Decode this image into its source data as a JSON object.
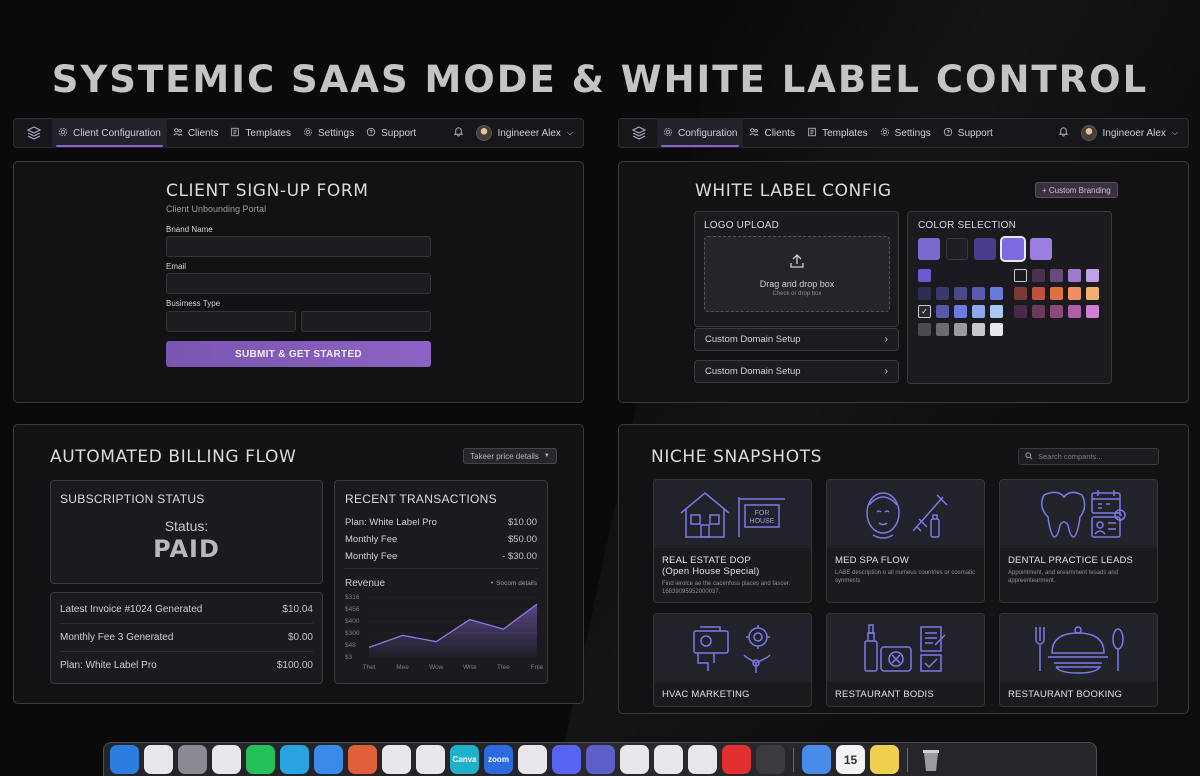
{
  "headline": "SYSTEMIC SAAS MODE & WHITE LABEL CONTROL",
  "nav_left": {
    "items": [
      {
        "label": "Client Configuration",
        "icon": "gear-icon",
        "active": true
      },
      {
        "label": "Clients",
        "icon": "users-icon"
      },
      {
        "label": "Templates",
        "icon": "template-icon"
      },
      {
        "label": "Settings",
        "icon": "gear-icon"
      },
      {
        "label": "Support",
        "icon": "help-icon"
      }
    ],
    "user": "Ingineeer Alex"
  },
  "nav_right": {
    "items": [
      {
        "label": "Configuration",
        "icon": "gear-icon",
        "active": true
      },
      {
        "label": "Clients",
        "icon": "users-icon"
      },
      {
        "label": "Templates",
        "icon": "template-icon"
      },
      {
        "label": "Settings",
        "icon": "gear-icon"
      },
      {
        "label": "Support",
        "icon": "help-icon"
      }
    ],
    "user": "Ingineoer Alex"
  },
  "signup": {
    "title": "CLIENT SIGN-UP FORM",
    "subtitle": "Client Unbounding Portal",
    "brand_label": "Bnand Name",
    "email_label": "Email",
    "business_label": "Busimess Type",
    "submit": "SUBMIT & GET STARTED"
  },
  "whitelabel": {
    "title": "WHITE LABEL CONFIG",
    "custom_branding": "+ Custom Branding",
    "logo_upload": "LOGO UPLOAD",
    "drop_title": "Drag and drop box",
    "drop_sub": "Check or drop box",
    "domain_1": "Custom Domain Setup",
    "domain_2": "Custom Domain Setup",
    "color_selection": "COLOR SELECTION",
    "top_swatches": [
      "#7a6ad0",
      "#1e1e24",
      "#4a3c8a",
      "#7e6ae0",
      "#9a80e0"
    ],
    "grid_left": [
      [
        "#6a5ad0",
        null,
        null,
        null,
        null
      ],
      [
        "#2e2e52",
        "#3a3a6a",
        "#4a4a8a",
        "#5a5ab0",
        "#6a7ad8"
      ],
      [
        "check",
        "#5a5aa8",
        "#6a7ae0",
        "#8aaaf0",
        "#a8c8f0"
      ],
      [
        "#4a4a52",
        "#6a6a72",
        "#9a9aa2",
        "#c8c8cc",
        "#e8e8ec"
      ]
    ],
    "grid_right": [
      [
        "outline",
        "#4a3250",
        "#6a4a7a",
        "#a07ad0",
        "#c0a0e8"
      ],
      [
        "#7a3a3a",
        "#c05040",
        "#e07040",
        "#f09060",
        "#f0b070"
      ],
      [
        "#4a2a4a",
        "#6a3a5a",
        "#8a4a7a",
        "#b060a8",
        "#d080d0"
      ]
    ]
  },
  "billing": {
    "title": "AUTOMATED BILLING FLOW",
    "dropdown": "Takeer price details",
    "sub_status_title": "SUBSCRIPTION STATUS",
    "status_label": "Status:",
    "status_value": "PAID",
    "rows": [
      {
        "label": "Latest Invoice #1024 Generated",
        "value": "$10.04"
      },
      {
        "label": "Monthly Fee 3 Generated",
        "value": "$0.00"
      },
      {
        "label": "Plan: White Label Pro",
        "value": "$100.00"
      }
    ],
    "recent_title": "RECENT TRANSACTIONS",
    "transactions": [
      {
        "label": "Plan: White Label Pro",
        "value": "$10.00"
      },
      {
        "label": "Monthly Fee",
        "value": "$50.00"
      },
      {
        "label": "Monthly Fee",
        "value": "- $30.00"
      }
    ],
    "revenue_label": "Revenue",
    "revenue_link": "Socom details"
  },
  "chart_data": {
    "type": "area",
    "title": "Revenue",
    "categories": [
      "Thet",
      "Mee",
      "Wow",
      "Wrte",
      "Tfee",
      "Fnie"
    ],
    "y_ticks": [
      "$316",
      "$456",
      "$400",
      "$300",
      "$48",
      "$3"
    ],
    "values": [
      20,
      45,
      32,
      78,
      58,
      110
    ],
    "ylim": [
      0,
      125
    ]
  },
  "niche": {
    "title": "NICHE SNAPSHOTS",
    "search_placeholder": "Search compants...",
    "tiles": [
      {
        "title": "REAL ESTATE DOP\n(Open House Special)",
        "desc": "Find ierolce ae the cacenfoss places and fascer. 16839095952000037.",
        "icon": "house-icon",
        "sign": "FOR HOUSE"
      },
      {
        "title": "MED SPA FLOW",
        "desc": "LABE description o all numeus countries or cosmatic synmests",
        "icon": "face-syringe-icon"
      },
      {
        "title": "DENTAL PRACTICE LEADS",
        "desc": "Appointment, and ereamment tesads and appreentearment.",
        "icon": "tooth-calendar-icon"
      },
      {
        "title": "HVAC MARKETING",
        "desc": "",
        "icon": "hvac-icon"
      },
      {
        "title": "RESTAURANT BODIS",
        "desc": "",
        "icon": "restaurant-icon"
      },
      {
        "title": "RESTAURANT BOOKING",
        "desc": "",
        "icon": "cloche-icon"
      }
    ]
  },
  "dock": {
    "icons": [
      {
        "name": "finder-icon",
        "color": "#2b7de0",
        "label": ""
      },
      {
        "name": "launchpad-icon",
        "color": "#e8e8ec",
        "label": ""
      },
      {
        "name": "settings-icon",
        "color": "#8a8a92",
        "label": ""
      },
      {
        "name": "creative-cloud-icon",
        "color": "#e8e8ec",
        "label": ""
      },
      {
        "name": "whatsapp-icon",
        "color": "#25c05a",
        "label": ""
      },
      {
        "name": "telegram-icon",
        "color": "#2aa3e0",
        "label": ""
      },
      {
        "name": "mail-icon",
        "color": "#3a8ae8",
        "label": ""
      },
      {
        "name": "claude-icon",
        "color": "#e0603a",
        "label": ""
      },
      {
        "name": "gemini-icon",
        "color": "#e8e8ec",
        "label": ""
      },
      {
        "name": "chrome-icon",
        "color": "#e8e8ec",
        "label": ""
      },
      {
        "name": "canva-icon",
        "color": "#20b0c8",
        "label": "Canva"
      },
      {
        "name": "zoom-icon",
        "color": "#2d6ae0",
        "label": "zoom"
      },
      {
        "name": "chat-icon",
        "color": "#e8e8ec",
        "label": ""
      },
      {
        "name": "discord-icon",
        "color": "#5865f2",
        "label": ""
      },
      {
        "name": "teams-icon",
        "color": "#5b5fc7",
        "label": ""
      },
      {
        "name": "openai-icon",
        "color": "#e8e8ec",
        "label": ""
      },
      {
        "name": "slack-icon",
        "color": "#e8e8ec",
        "label": ""
      },
      {
        "name": "drive-icon",
        "color": "#e8e8ec",
        "label": ""
      },
      {
        "name": "record-icon",
        "color": "#e03030",
        "label": ""
      },
      {
        "name": "calculator-icon",
        "color": "#3a3a40",
        "label": ""
      }
    ],
    "icons_right": [
      {
        "name": "screen-icon",
        "color": "#4a8ae8",
        "label": ""
      },
      {
        "name": "calendar-icon",
        "color": "#f4f4f6",
        "label": "15"
      },
      {
        "name": "notes-icon",
        "color": "#f0d050",
        "label": ""
      }
    ],
    "trash": {
      "name": "trash-icon",
      "color": "#b0b0b6"
    }
  }
}
